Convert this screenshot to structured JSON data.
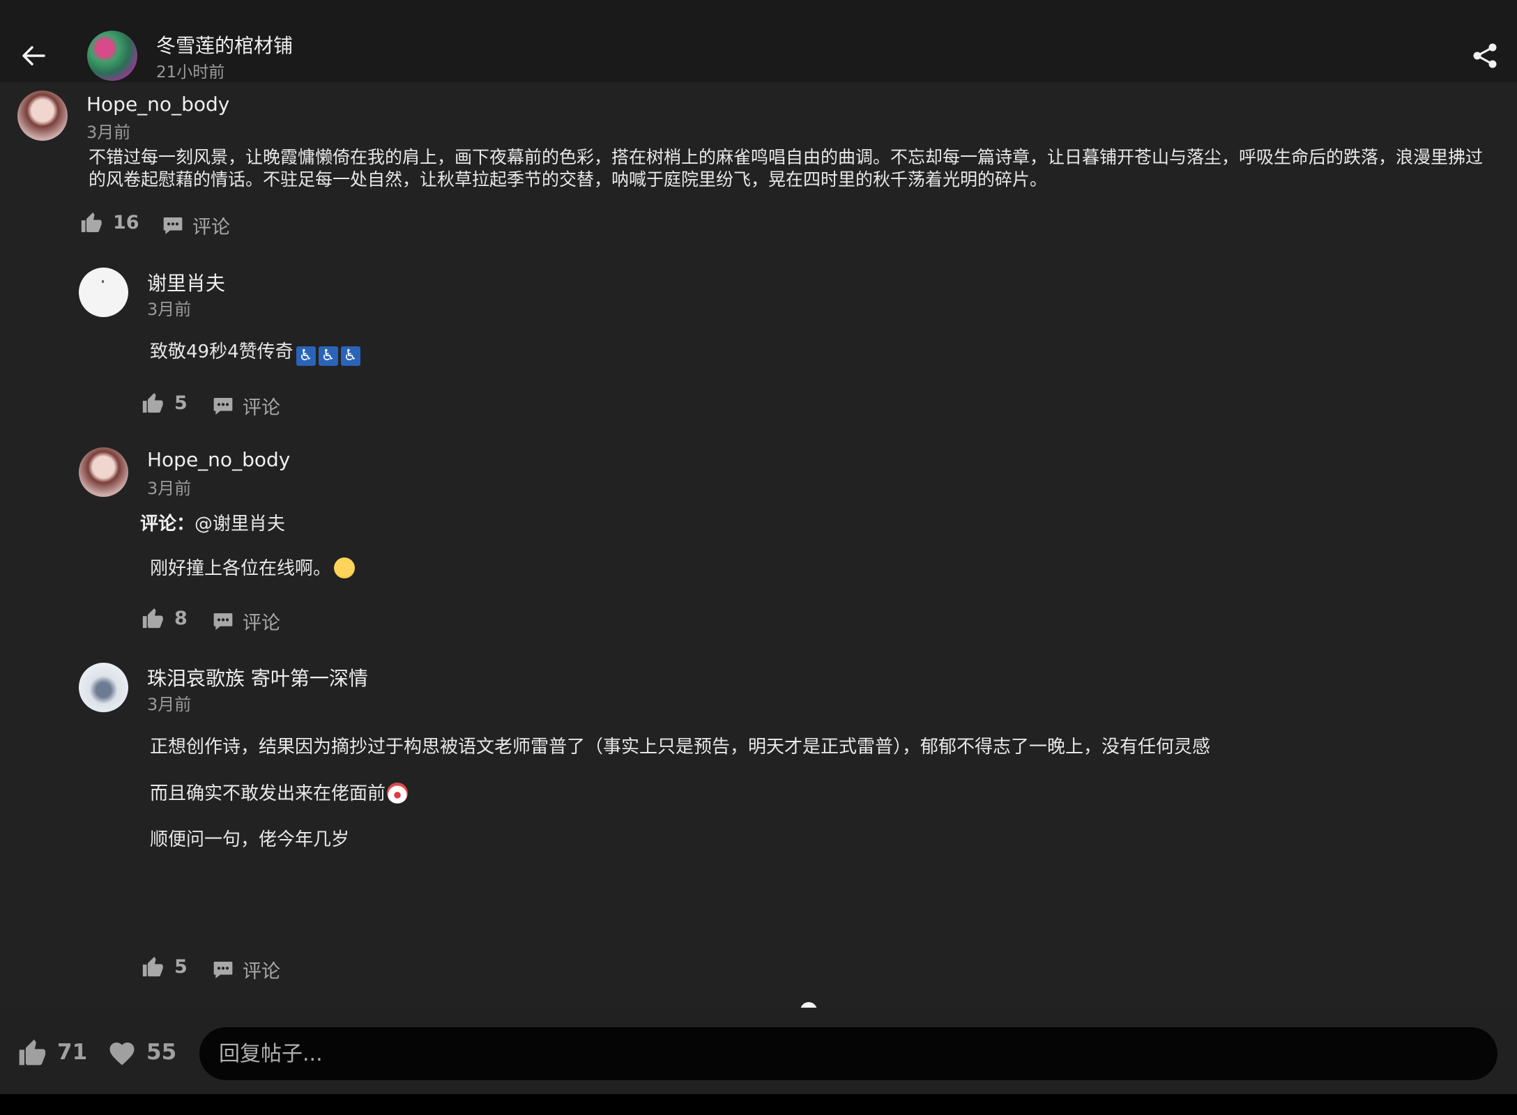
{
  "header": {
    "title": "冬雪莲的棺材铺",
    "time": "21小时前"
  },
  "main_comment": {
    "user": "Hope_no_body",
    "time": "3月前",
    "text": "不错过每一刻风景，让晚霞慵懒倚在我的肩上，画下夜幕前的色彩，搭在树梢上的麻雀鸣唱自由的曲调。不忘却每一篇诗章，让日暮铺开苍山与落尘，呼吸生命后的跌落，浪漫里拂过的风卷起慰藉的情话。不驻足每一处自然，让秋草拉起季节的交替，呐喊于庭院里纷飞，晃在四时里的秋千荡着光明的碎片。",
    "likes": "16",
    "comment_label": "评论"
  },
  "replies": [
    {
      "user": "谢里肖夫",
      "time": "3月前",
      "text": "致敬49秒4赞传奇",
      "emoji": "♿",
      "likes": "5",
      "comment_label": "评论"
    },
    {
      "user": "Hope_no_body",
      "time": "3月前",
      "reply_prefix": "评论：",
      "reply_to": "@谢里肖夫",
      "text": "刚好撞上各位在线啊。",
      "likes": "8",
      "comment_label": "评论"
    },
    {
      "user": "珠泪哀歌族 寄叶第一深情",
      "time": "3月前",
      "paragraphs": [
        "正想创作诗，结果因为摘抄过于构思被语文老师雷普了（事实上只是预告，明天才是正式雷普），郁郁不得志了一晚上，没有任何灵感",
        "而且确实不敢发出来在佬面前",
        "顺便问一句，佬今年几岁"
      ],
      "likes": "5",
      "comment_label": "评论"
    }
  ],
  "bottom": {
    "likes": "71",
    "favorites": "55",
    "reply_placeholder": "回复帖子..."
  },
  "icons": {
    "back": "arrow-left-icon",
    "share": "share-icon",
    "like": "thumbs-up-icon",
    "comment": "comment-bubble-icon",
    "favorite": "heart-icon"
  },
  "colors": {
    "background": "#222222",
    "header": "#1a1a1a",
    "input": "#050505",
    "muted": "#9a9a9a"
  }
}
